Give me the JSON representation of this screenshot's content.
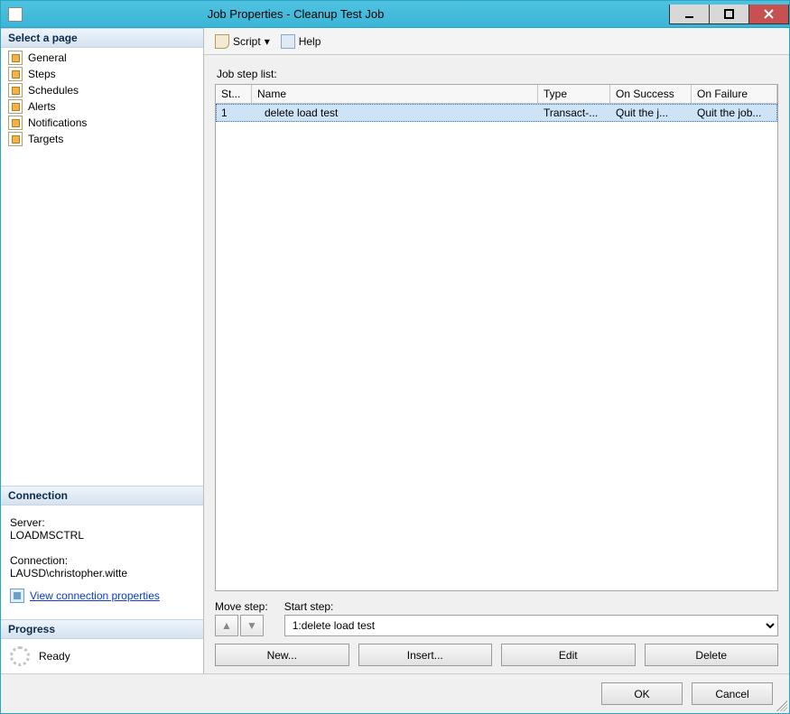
{
  "window": {
    "title": "Job Properties - Cleanup Test Job"
  },
  "sidebar": {
    "select_label": "Select a page",
    "items": [
      {
        "label": "General"
      },
      {
        "label": "Steps"
      },
      {
        "label": "Schedules"
      },
      {
        "label": "Alerts"
      },
      {
        "label": "Notifications"
      },
      {
        "label": "Targets"
      }
    ],
    "connection": {
      "header": "Connection",
      "server_label": "Server:",
      "server_value": "LOADMSCTRL",
      "connection_label": "Connection:",
      "connection_value": "LAUSD\\christopher.witte",
      "view_link": "View connection properties"
    },
    "progress": {
      "header": "Progress",
      "status": "Ready"
    }
  },
  "toolbar": {
    "script_label": "Script",
    "help_label": "Help"
  },
  "main": {
    "list_label": "Job step list:",
    "columns": {
      "step": "St...",
      "name": "Name",
      "type": "Type",
      "on_success": "On Success",
      "on_failure": "On Failure"
    },
    "rows": [
      {
        "step": "1",
        "name": "delete load test",
        "type": "Transact-...",
        "on_success": "Quit the j...",
        "on_failure": "Quit the job..."
      }
    ],
    "move_label": "Move step:",
    "start_label": "Start step:",
    "start_selected": "1:delete load test",
    "buttons": {
      "new": "New...",
      "insert": "Insert...",
      "edit": "Edit",
      "delete": "Delete"
    }
  },
  "footer": {
    "ok": "OK",
    "cancel": "Cancel"
  }
}
